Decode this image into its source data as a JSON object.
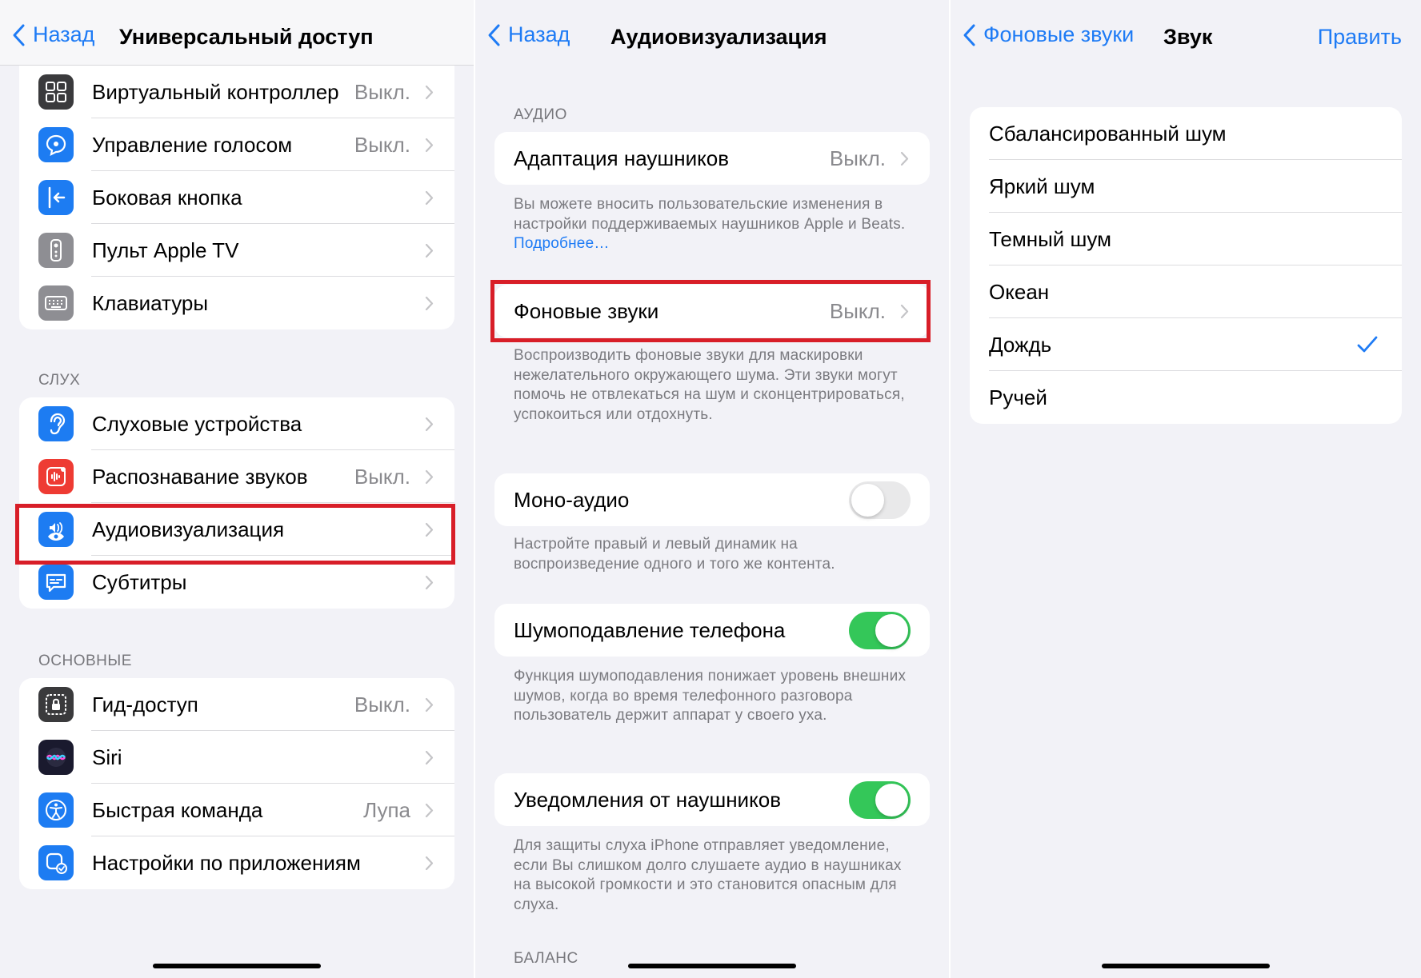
{
  "screen1": {
    "back_label": "Назад",
    "title": "Универсальный доступ",
    "top_items": [
      {
        "label": "Виртуальный контроллер",
        "value": "Выкл.",
        "icon": "grid-icon",
        "color": "#3a3a3c"
      },
      {
        "label": "Управление голосом",
        "value": "Выкл.",
        "icon": "voice-control-icon",
        "color": "#1d7cf2"
      },
      {
        "label": "Боковая кнопка",
        "value": "",
        "icon": "side-button-icon",
        "color": "#1d7cf2"
      },
      {
        "label": "Пульт Apple TV",
        "value": "",
        "icon": "remote-icon",
        "color": "#8e8e93"
      },
      {
        "label": "Клавиатуры",
        "value": "",
        "icon": "keyboard-icon",
        "color": "#8e8e93"
      }
    ],
    "hearing_header": "СЛУХ",
    "hearing_items": [
      {
        "label": "Слуховые устройства",
        "value": "",
        "icon": "ear-icon",
        "color": "#1d7cf2"
      },
      {
        "label": "Распознавание звуков",
        "value": "Выкл.",
        "icon": "waveform-icon",
        "color": "#ee3b33"
      },
      {
        "label": "Аудиовизуализация",
        "value": "",
        "icon": "audio-visual-icon",
        "color": "#1d7cf2"
      },
      {
        "label": "Субтитры",
        "value": "",
        "icon": "subtitles-icon",
        "color": "#1d7cf2"
      }
    ],
    "general_header": "ОСНОВНЫЕ",
    "general_items": [
      {
        "label": "Гид-доступ",
        "value": "Выкл.",
        "icon": "lock-icon",
        "color": "#3a3a3c"
      },
      {
        "label": "Siri",
        "value": "",
        "icon": "siri-icon",
        "color": "#1a1a2e"
      },
      {
        "label": "Быстрая команда",
        "value": "Лупа",
        "icon": "accessibility-icon",
        "color": "#1d7cf2"
      },
      {
        "label": "Настройки по приложениям",
        "value": "",
        "icon": "app-settings-icon",
        "color": "#1d7cf2"
      }
    ]
  },
  "screen2": {
    "back_label": "Назад",
    "title": "Аудиовизуализация",
    "audio_header": "АУДИО",
    "headphone_label": "Адаптация наушников",
    "headphone_value": "Выкл.",
    "headphone_note": "Вы можете вносить пользовательские изменения в настройки поддерживаемых наушников Apple и Beats.",
    "headphone_link": "Подробнее…",
    "bg_sounds_label": "Фоновые звуки",
    "bg_sounds_value": "Выкл.",
    "bg_sounds_note": "Воспроизводить фоновые звуки для маскировки нежелательного окружающего шума. Эти звуки могут помочь не отвлекаться на шум и сконцентрироваться, успокоиться или отдохнуть.",
    "mono_label": "Моно-аудио",
    "mono_on": false,
    "mono_note": "Настройте правый и левый динамик на воспроизведение одного и того же контента.",
    "noise_label": "Шумоподавление телефона",
    "noise_on": true,
    "noise_note": "Функция шумоподавления понижает уровень внешних шумов, когда во время телефонного разговора пользователь держит аппарат у своего уха.",
    "notif_label": "Уведомления от наушников",
    "notif_on": true,
    "notif_note": "Для защиты слуха iPhone отправляет уведомление, если Вы слишком долго слушаете аудио в наушниках на высокой громкости и это становится опасным для слуха.",
    "balance_header": "БАЛАНС"
  },
  "screen3": {
    "back_label": "Фоновые звуки",
    "title": "Звук",
    "edit_label": "Править",
    "sounds": [
      {
        "label": "Сбалансированный шум",
        "selected": false
      },
      {
        "label": "Яркий шум",
        "selected": false
      },
      {
        "label": "Темный шум",
        "selected": false
      },
      {
        "label": "Океан",
        "selected": false
      },
      {
        "label": "Дождь",
        "selected": true
      },
      {
        "label": "Ручей",
        "selected": false
      }
    ]
  },
  "colors": {
    "accent": "#1e7bf5",
    "highlight": "#d81e28",
    "toggle_on": "#34c759",
    "toggle_off": "#e9e9ea"
  }
}
